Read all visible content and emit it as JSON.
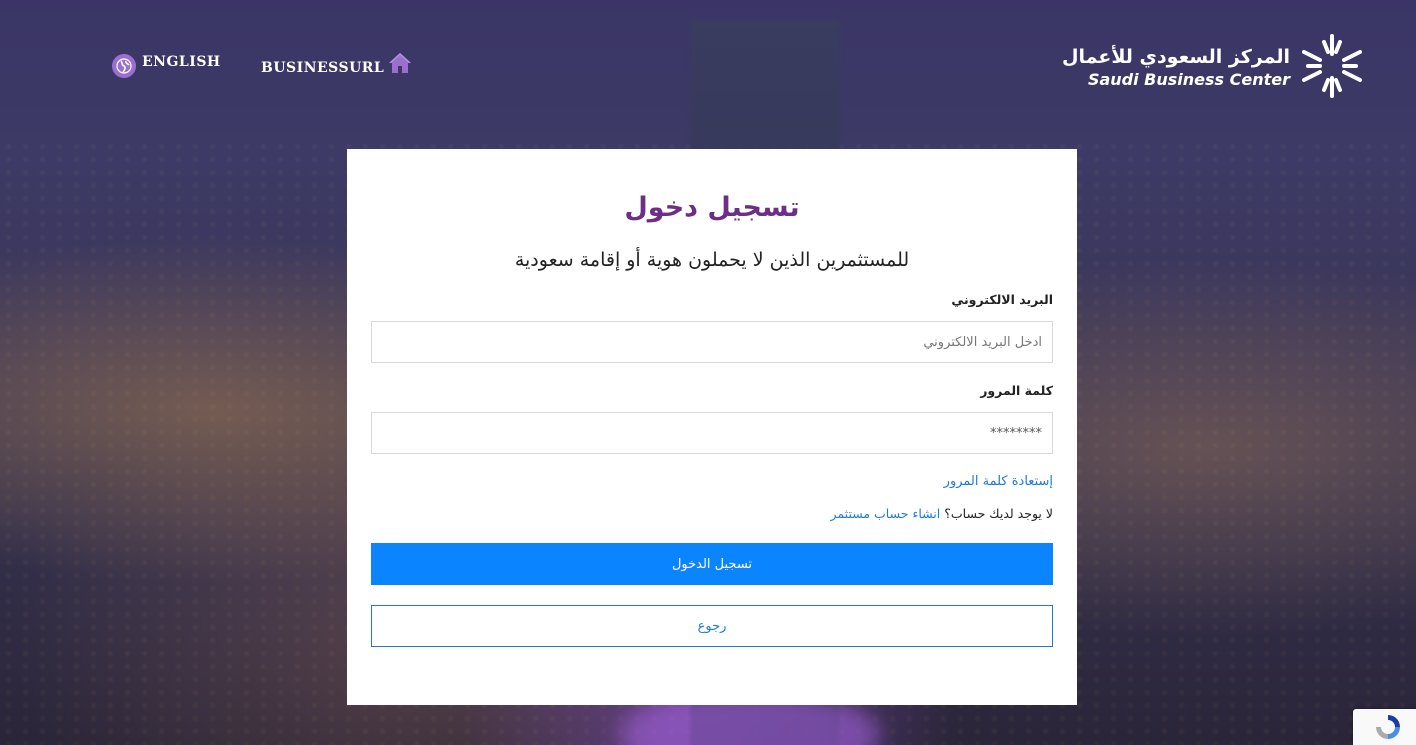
{
  "header": {
    "language_label": "ENGLISH",
    "business_url_label": "BUSINESSURL",
    "logo_arabic": "المركز السعودي للأعمال",
    "logo_english": "Saudi Business Center"
  },
  "login": {
    "title": "تسجيل دخول",
    "subtitle": "للمستثمرين الذين لا يحملون هوية أو إقامة سعودية",
    "email_label": "البريد الالكتروني",
    "email_placeholder": "ادخل البريد الالكتروني",
    "password_label": "كلمة المرور",
    "password_value": "********",
    "forgot_password": "إستعادة كلمة المرور",
    "no_account_text": "لا يوجد لديك حساب؟",
    "create_account": "انشاء حساب مستثمر",
    "login_button": "تسجيل الدخول",
    "back_button": "رجوع"
  },
  "colors": {
    "title": "#6b2f85",
    "primary_button": "#0a84ff",
    "link": "#1f7ad6",
    "globe_icon": "#9b6fcf"
  },
  "icons": {
    "language": "globe-icon",
    "business_url": "home-icon",
    "logo": "sbc-star-logo-icon",
    "captcha": "recaptcha-icon"
  }
}
